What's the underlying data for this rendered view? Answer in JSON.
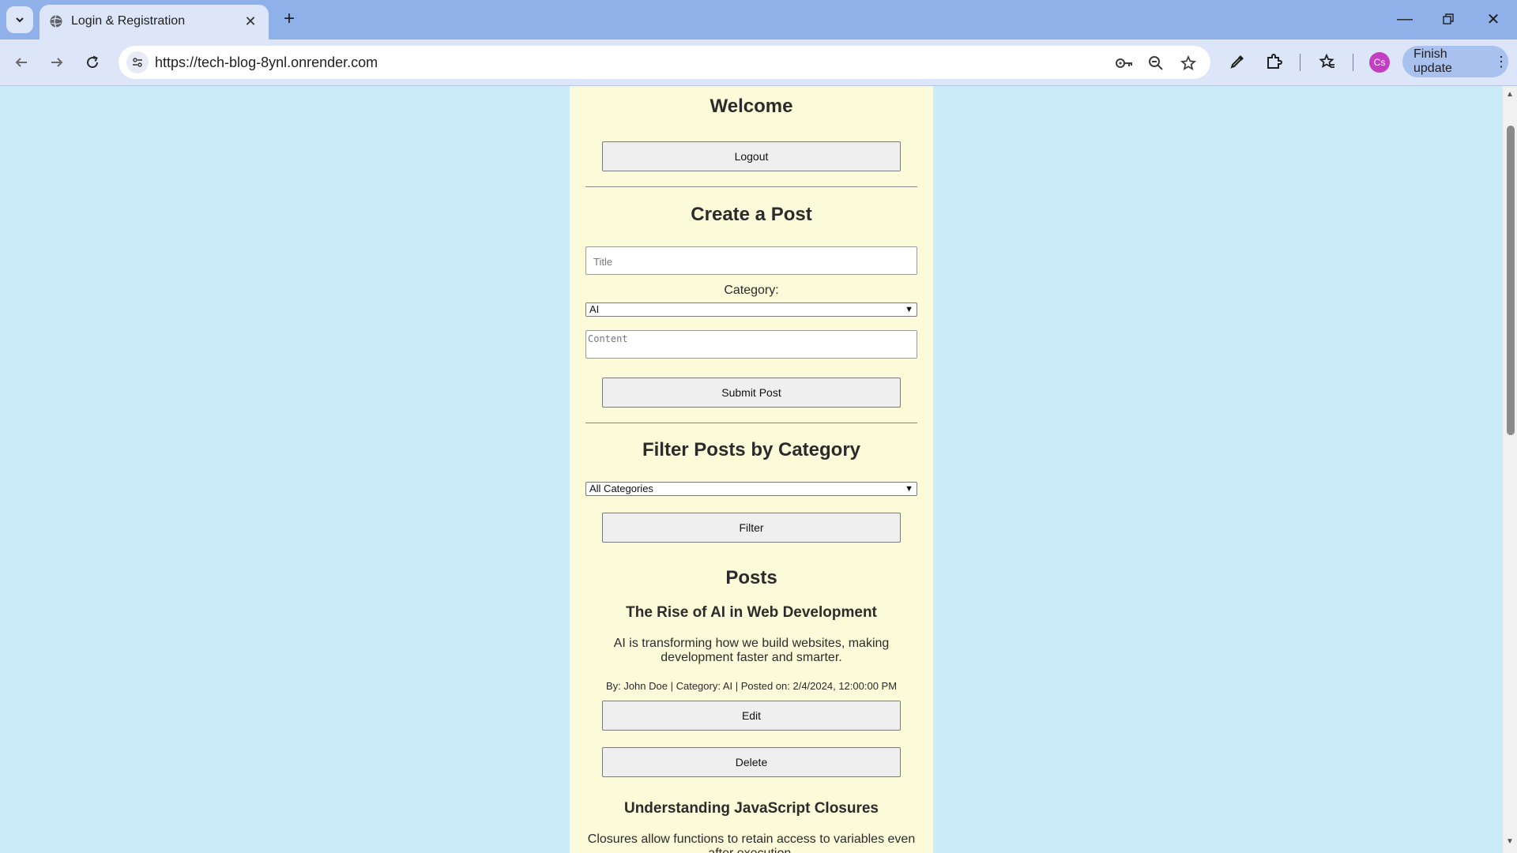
{
  "browser": {
    "tab_title": "Login & Registration",
    "url": "https://tech-blog-8ynl.onrender.com",
    "profile_initials": "Cs",
    "update_label": "Finish update"
  },
  "page": {
    "welcome_heading": "Welcome",
    "logout_label": "Logout",
    "create_heading": "Create a Post",
    "title_placeholder": "Title",
    "category_label": "Category:",
    "category_selected": "AI",
    "content_placeholder": "Content",
    "submit_label": "Submit Post",
    "filter_heading": "Filter Posts by Category",
    "filter_selected": "All Categories",
    "filter_label": "Filter",
    "posts_heading": "Posts",
    "posts": [
      {
        "title": "The Rise of AI in Web Development",
        "body": "AI is transforming how we build websites, making development faster and smarter.",
        "meta": "By: John Doe | Category: AI | Posted on: 2/4/2024, 12:00:00 PM",
        "edit_label": "Edit",
        "delete_label": "Delete"
      },
      {
        "title": "Understanding JavaScript Closures",
        "body": "Closures allow functions to retain access to variables even after execution."
      }
    ]
  }
}
